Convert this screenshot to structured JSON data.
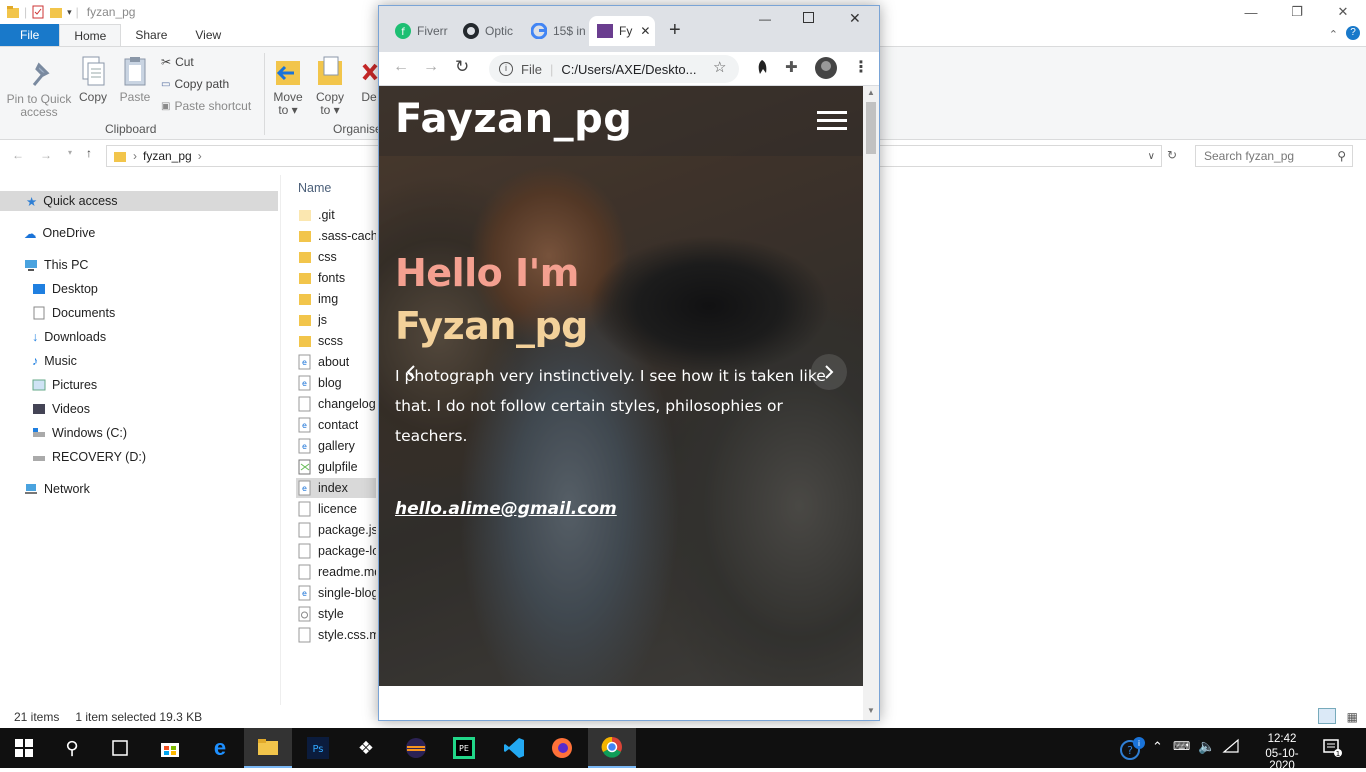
{
  "explorer": {
    "title": "fyzan_pg",
    "tabs": {
      "file": "File",
      "home": "Home",
      "share": "Share",
      "view": "View"
    },
    "ribbon": {
      "pin": "Pin to Quick access",
      "pin_l1": "Pin to Quick",
      "pin_l2": "access",
      "copy": "Copy",
      "paste": "Paste",
      "cut": "Cut",
      "copy_path": "Copy path",
      "paste_shortcut": "Paste shortcut",
      "clipboard": "Clipboard",
      "move_l1": "Move",
      "move_l2": "to",
      "copy_l1": "Copy",
      "copy_l2": "to",
      "delete": "De",
      "organise": "Organise"
    },
    "breadcrumb": "fyzan_pg",
    "search_placeholder": "Search fyzan_pg",
    "column_name": "Name",
    "nav": {
      "quick_access": "Quick access",
      "onedrive": "OneDrive",
      "this_pc": "This PC",
      "desktop": "Desktop",
      "documents": "Documents",
      "downloads": "Downloads",
      "music": "Music",
      "pictures": "Pictures",
      "videos": "Videos",
      "windows_c": "Windows (C:)",
      "recovery_d": "RECOVERY (D:)",
      "network": "Network"
    },
    "files": [
      ".git",
      ".sass-cache",
      "css",
      "fonts",
      "img",
      "js",
      "scss",
      "about",
      "blog",
      "changelog",
      "contact",
      "gallery",
      "gulpfile",
      "index",
      "licence",
      "package.json",
      "package-lock",
      "readme.md",
      "single-blog",
      "style",
      "style.css.map"
    ],
    "status_items": "21 items",
    "status_selected": "1 item selected  19.3 KB"
  },
  "chrome": {
    "tabs": [
      {
        "label": "Fiverr"
      },
      {
        "label": "Optic"
      },
      {
        "label": "15$ in"
      },
      {
        "label": "Fy"
      }
    ],
    "url": "C:/Users/AXE/Deskto...",
    "url_scheme": "File",
    "page": {
      "brand": "Fayzan_pg",
      "heading_line1": "Hello I'm",
      "heading_line2": "Fyzan_pg",
      "para1": "I photograph very instinctively. I see how it is taken like",
      "para2": "that. I do not follow certain styles, philosophies or",
      "para3": "teachers.",
      "email": "hello.alime@gmail.com"
    },
    "colors": {
      "heading1": "#f4a090",
      "heading2": "#f3d19a"
    }
  },
  "taskbar": {
    "time": "12:42",
    "date": "05-10-2020"
  }
}
